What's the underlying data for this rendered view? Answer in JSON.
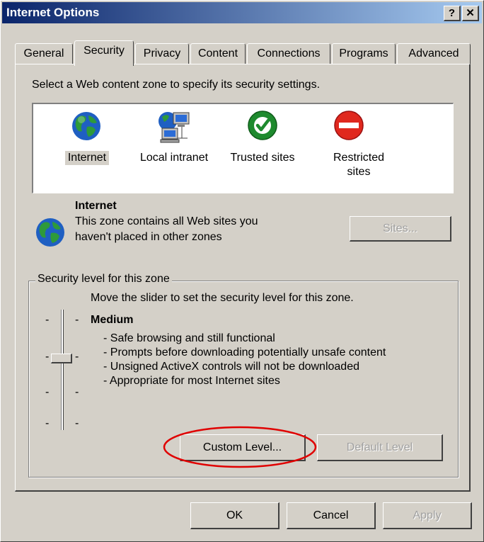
{
  "window": {
    "title": "Internet Options",
    "help_glyph": "?",
    "close_glyph": "✕"
  },
  "tabs": [
    {
      "label": "General"
    },
    {
      "label": "Security"
    },
    {
      "label": "Privacy"
    },
    {
      "label": "Content"
    },
    {
      "label": "Connections"
    },
    {
      "label": "Programs"
    },
    {
      "label": "Advanced"
    }
  ],
  "active_tab": "Security",
  "security": {
    "instruction": "Select a Web content zone to specify its security settings.",
    "zones": [
      {
        "label": "Internet",
        "icon": "globe-icon"
      },
      {
        "label": "Local intranet",
        "icon": "network-computers-icon"
      },
      {
        "label": "Trusted sites",
        "icon": "checkmark-icon"
      },
      {
        "label": "Restricted sites",
        "icon": "no-entry-icon"
      }
    ],
    "selected_zone": "Internet",
    "zone_info": {
      "name": "Internet",
      "description_line1": "This zone contains all Web sites you",
      "description_line2": "haven't placed in other zones"
    },
    "sites_button": "Sites...",
    "level_group_label": "Security level for this zone",
    "slider_instruction": "Move the slider to set the security level for this zone.",
    "level_name": "Medium",
    "level_bullets": [
      "- Safe browsing and still functional",
      "- Prompts before downloading potentially unsafe content",
      "- Unsigned ActiveX controls will not be downloaded",
      "- Appropriate for most Internet sites"
    ],
    "custom_level_button": "Custom Level...",
    "default_level_button": "Default Level"
  },
  "footer": {
    "ok": "OK",
    "cancel": "Cancel",
    "apply": "Apply"
  },
  "colors": {
    "titlebar_start": "#0a246a",
    "titlebar_end": "#a6caf0",
    "face": "#d4d0c8",
    "highlight_ellipse": "#e00000"
  }
}
